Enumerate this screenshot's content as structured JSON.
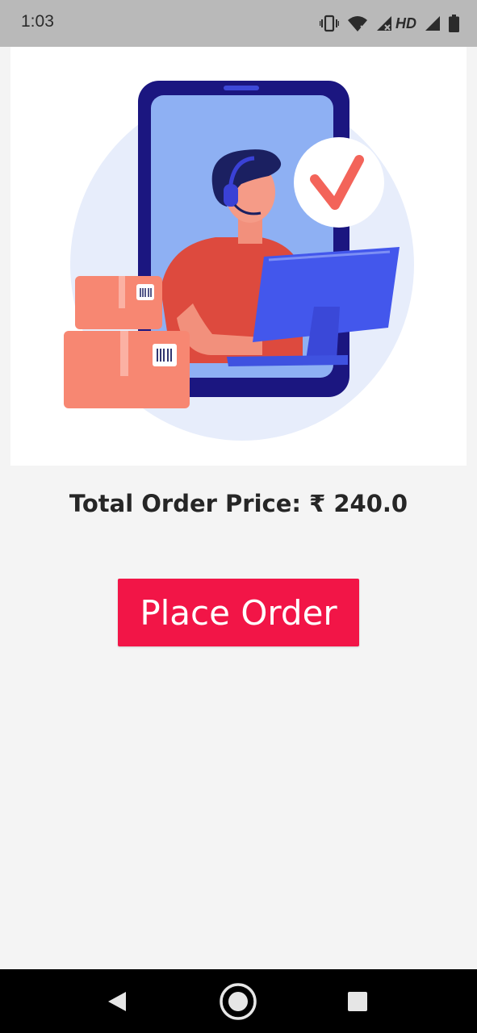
{
  "status_bar": {
    "time": "1:03",
    "network_label": "HD",
    "icons": [
      "vibrate-icon",
      "wifi-icon",
      "signal-icon",
      "signal-icon",
      "battery-icon"
    ]
  },
  "hero": {
    "illustration": "customer-support-order-confirmed-illustration",
    "check_icon": "checkmark-icon"
  },
  "order": {
    "total_label": "Total Order Price: ₹ 240.0",
    "place_order_label": "Place Order"
  },
  "nav_bar": {
    "icons": [
      "back-icon",
      "home-icon",
      "recents-icon"
    ]
  },
  "colors": {
    "accent": "#f21547",
    "background": "#f4f4f4",
    "status_bar": "#b9b9b9",
    "nav_bar": "#000000"
  }
}
